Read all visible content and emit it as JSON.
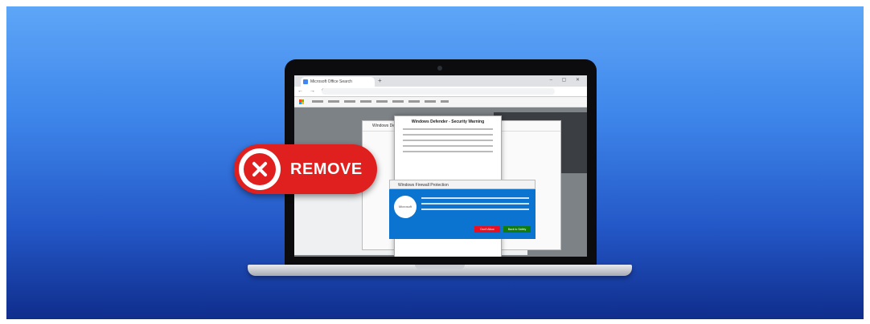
{
  "badge": {
    "label": "REMOVE",
    "icon": "close-icon"
  },
  "browser": {
    "tab_title": "Microsoft Office Search",
    "new_tab_glyph": "+"
  },
  "popups": {
    "back_title": "Windows Defender",
    "center_title": "Windows Defender - Security Warning",
    "blue_header": "Windows Firewall Protection",
    "ms_circle": "Microsoft",
    "deny_button": "Don't Allow",
    "allow_button": "Back to Safety"
  },
  "colors": {
    "badge": "#e01f1f",
    "background_top": "#5ea6f7",
    "background_bottom": "#0f2d8c"
  }
}
